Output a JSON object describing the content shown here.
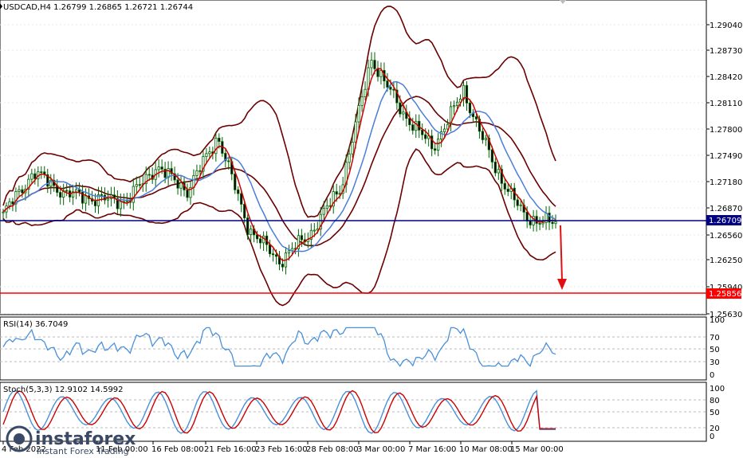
{
  "header": {
    "symbol_info": "USDCAD,H4  1.26799 1.26865 1.26721 1.26744",
    "rsi_label": "RSI(14) 36.7049",
    "stoch_label": "Stoch(5,3,3) 12.9102 14.5992"
  },
  "price_axis": {
    "ticks": [
      "1.29040",
      "1.28730",
      "1.28420",
      "1.28110",
      "1.27800",
      "1.27490",
      "1.27180",
      "1.26870",
      "1.26560",
      "1.26250",
      "1.25940",
      "1.25630"
    ],
    "current_price_tag": "1.26709",
    "target_price_tag": "1.25856"
  },
  "rsi_axis": {
    "ticks": [
      "100",
      "70",
      "50",
      "30",
      "0"
    ]
  },
  "stoch_axis": {
    "ticks": [
      "100",
      "80",
      "50",
      "20",
      "0"
    ]
  },
  "time_axis": {
    "labels": [
      "4 Feb 2022",
      "11 Feb 00:00",
      "16 Feb 08:00",
      "21 Feb 16:00",
      "23 Feb 16:00",
      "28 Feb 08:00",
      "3 Mar 00:00",
      "7 Mar 16:00",
      "10 Mar 08:00",
      "15 Mar 00:00"
    ]
  },
  "watermark": {
    "brand": "instaforex",
    "tagline": "Instant Forex Trading"
  },
  "colors": {
    "candle": "#006400",
    "bollinger": "#6b0000",
    "ma_fast": "#cc0000",
    "ma_slow": "#4a7ed8",
    "support_line": "#000080",
    "target_line": "#ff0000",
    "rsi_line": "#4a90d9",
    "stoch_main": "#4a90d9",
    "stoch_signal": "#cc0000"
  },
  "chart_data": {
    "type": "line",
    "instrument": "USDCAD",
    "timeframe": "H4",
    "x": [
      "4 Feb 2022",
      "11 Feb 00:00",
      "16 Feb 08:00",
      "21 Feb 16:00",
      "23 Feb 16:00",
      "28 Feb 08:00",
      "3 Mar 00:00",
      "7 Mar 16:00",
      "10 Mar 08:00",
      "15 Mar 00:00"
    ],
    "series": [
      {
        "values": [
          1.2686,
          1.2738,
          1.2712,
          1.2705,
          1.2702,
          1.2745,
          1.2715,
          1.2782,
          1.2668,
          1.2628,
          1.2662,
          1.2719,
          1.2878,
          1.2812,
          1.2768,
          1.2838,
          1.2745,
          1.2682,
          1.2674
        ]
      }
    ],
    "horizontal_levels": [
      1.26709,
      1.25856
    ],
    "rsi": {
      "last": 36.7049,
      "levels": [
        70,
        50,
        30
      ]
    },
    "stochastic": {
      "main": 12.9102,
      "signal": 14.5992,
      "levels": [
        80,
        50,
        20
      ]
    },
    "ylim": [
      1.2563,
      1.292
    ]
  }
}
